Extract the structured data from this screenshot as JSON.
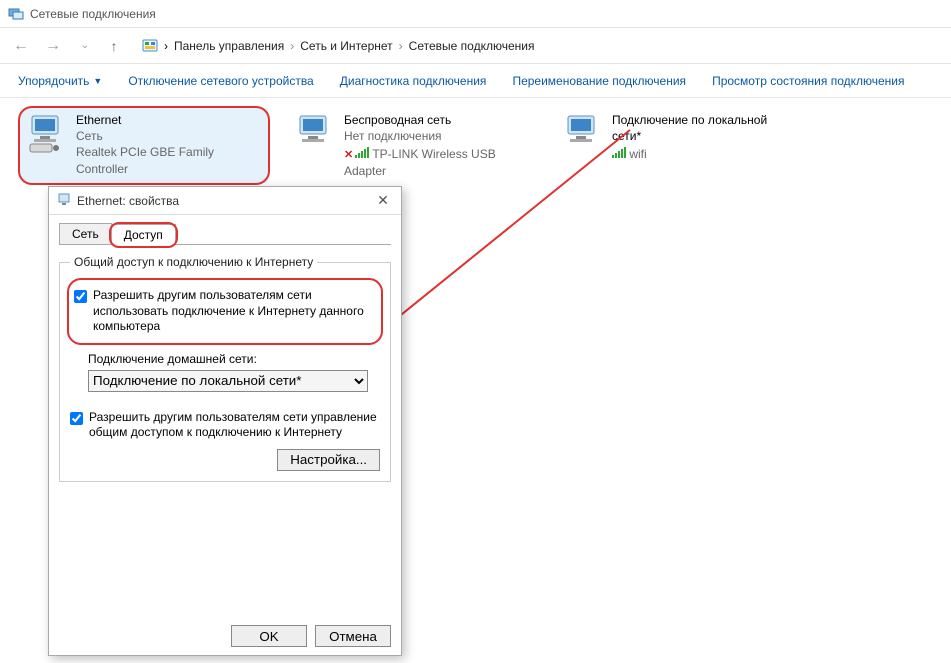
{
  "window": {
    "title": "Сетевые подключения"
  },
  "breadcrumb": {
    "root": "Панель управления",
    "mid": "Сеть и Интернет",
    "leaf": "Сетевые подключения"
  },
  "toolbar": {
    "organize": "Упорядочить",
    "disable": "Отключение сетевого устройства",
    "diagnose": "Диагностика подключения",
    "rename": "Переименование подключения",
    "status": "Просмотр состояния подключения"
  },
  "connections": {
    "ethernet": {
      "title": "Ethernet",
      "sub": "Сеть",
      "dev": "Realtek PCIe GBE Family Controller"
    },
    "wireless": {
      "title": "Беспроводная сеть",
      "sub": "Нет подключения",
      "dev": "TP-LINK Wireless USB Adapter"
    },
    "local": {
      "title": "Подключение по локальной сети*",
      "sub": "wifi",
      "dev": ""
    }
  },
  "dialog": {
    "title": "Ethernet: свойства",
    "tabs": {
      "net": "Сеть",
      "share": "Доступ"
    },
    "group_title": "Общий доступ к подключению к Интернету",
    "chk_allow": "Разрешить другим пользователям сети использовать подключение к Интернету данного компьютера",
    "home_label": "Подключение домашней сети:",
    "home_value": "Подключение по локальной сети*",
    "chk_control": "Разрешить другим пользователям сети управление общим доступом к подключению к Интернету",
    "settings_btn": "Настройка...",
    "ok": "OK",
    "cancel": "Отмена"
  }
}
